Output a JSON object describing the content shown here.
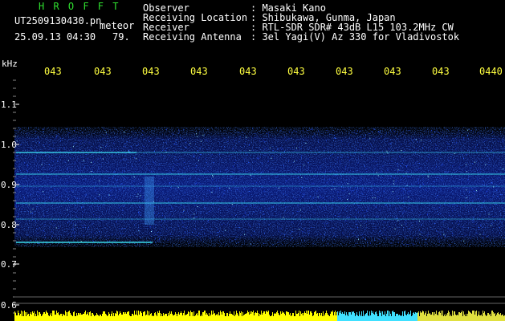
{
  "header": {
    "brand": "H R O F F T",
    "filename": "UT2509130430.pn",
    "mode": "meteor",
    "datetime": "25.09.13 04:30",
    "score": "79.",
    "meta": [
      {
        "label": "Observer",
        "value": ": Masaki Kano"
      },
      {
        "label": "Receiving Location",
        "value": ": Shibukawa, Gunma, Japan"
      },
      {
        "label": "Receiver",
        "value": ": RTL-SDR SDR# 43dB L15 103.2MHz CW"
      },
      {
        "label": "Receiving Antenna",
        "value": ": 3el Yagi(V) Az 330 for Vladivostok"
      }
    ]
  },
  "spectrogram": {
    "unit": "kHz",
    "x_ticks": [
      "043",
      "043",
      "043",
      "043",
      "043",
      "043",
      "043",
      "043",
      "043",
      "0440"
    ],
    "y_ticks": [
      "1.1",
      "1.0",
      "0.9",
      "0.8",
      "0.7",
      "0.6"
    ],
    "colors": {
      "noise": "#1030d0",
      "signal": "#40f0ff",
      "axis_text": "#ffff40"
    }
  }
}
